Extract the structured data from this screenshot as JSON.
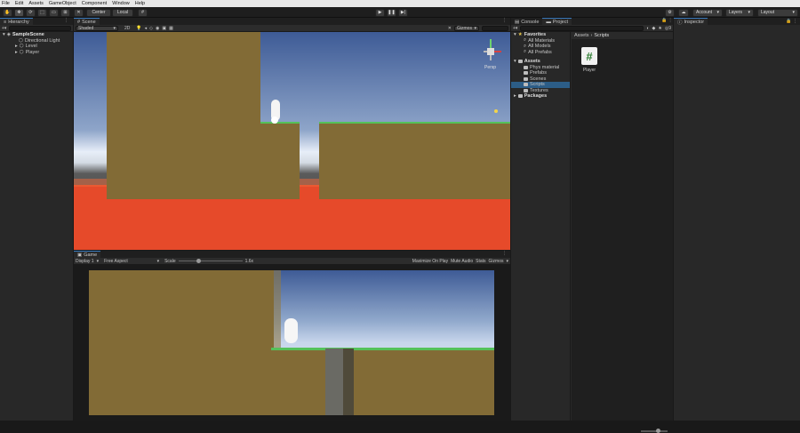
{
  "menu": [
    "File",
    "Edit",
    "Assets",
    "GameObject",
    "Component",
    "Window",
    "Help"
  ],
  "toolbar": {
    "pivot_mode": "Center",
    "space_mode": "Local",
    "account": "Account",
    "layers": "Layers",
    "layout": "Layout"
  },
  "hierarchy": {
    "tab": "Hierarchy",
    "scene": "SampleScene",
    "items": [
      "Directional Light",
      "Level",
      "Player"
    ]
  },
  "scene_view": {
    "tab": "Scene",
    "shading": "Shaded",
    "mode_2d": "2D",
    "gizmos": "Gizmos",
    "projection": "Persp"
  },
  "game_view": {
    "tab": "Game",
    "display": "Display 1",
    "aspect": "Free Aspect",
    "scale_label": "Scale",
    "scale_value": "1.6x",
    "maximize": "Maximize On Play",
    "mute": "Mute Audio",
    "stats": "Stats",
    "gizmos": "Gizmos",
    "scale_fraction": 0.3
  },
  "project": {
    "tab_console": "Console",
    "tab_project": "Project",
    "favorites_label": "Favorites",
    "favorites": [
      "All Materials",
      "All Models",
      "All Prefabs"
    ],
    "assets_label": "Assets",
    "assets": [
      "Phys material",
      "Prefabs",
      "Scenes",
      "Scripts",
      "Textures"
    ],
    "packages_label": "Packages",
    "breadcrumb_root": "Assets",
    "breadcrumb_current": "Scripts",
    "files": [
      {
        "name": "Player",
        "icon": "csharp-script-icon"
      }
    ]
  },
  "inspector": {
    "tab": "Inspector"
  },
  "colors": {
    "lava": "#e64a2a",
    "ground": "#826b36",
    "grass": "#55c15a",
    "sky_top": "#3e5b96",
    "sky_low": "#c8d6ec",
    "accent": "#3a79bb"
  }
}
